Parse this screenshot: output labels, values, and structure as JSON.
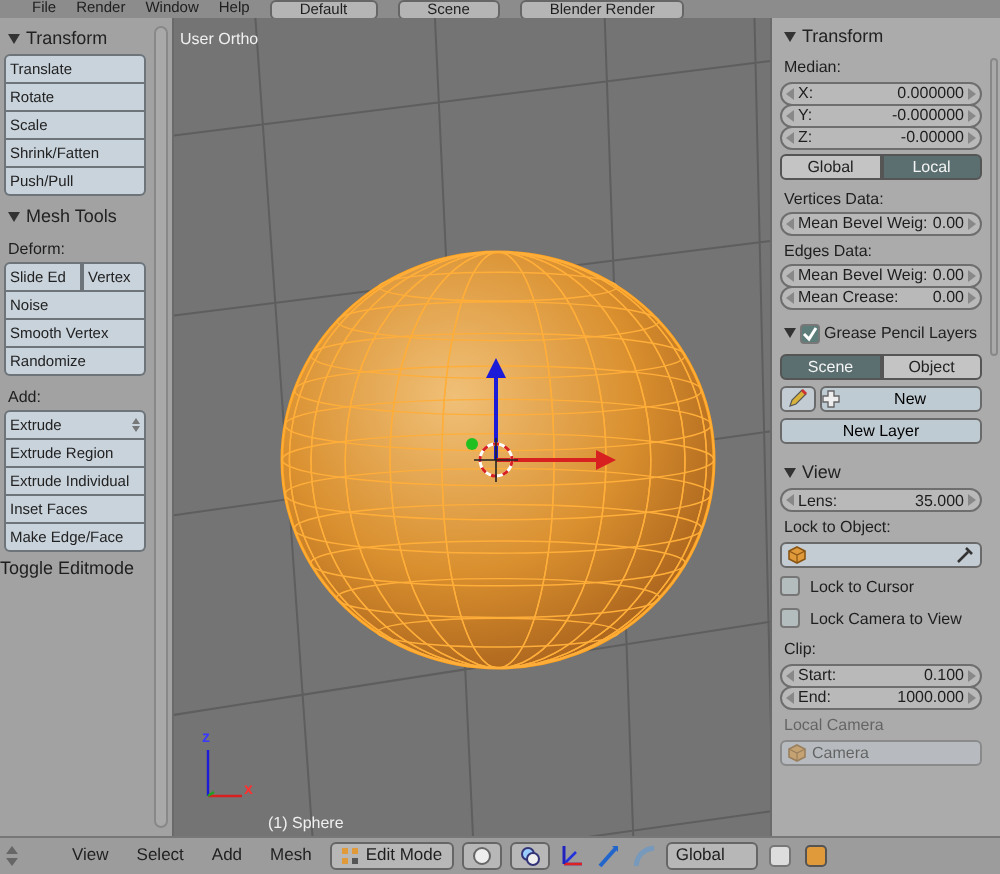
{
  "top_bar": {
    "menus": [
      "File",
      "Render",
      "Window",
      "Help"
    ],
    "layout": "Default",
    "scene": "Scene",
    "engine": "Blender Render"
  },
  "tool_shelf": {
    "panels": [
      {
        "title": "Transform",
        "items": [
          {
            "kind": "buttons",
            "buttons": [
              "Translate",
              "Rotate",
              "Scale",
              "Shrink/Fatten",
              "Push/Pull"
            ]
          }
        ]
      },
      {
        "title": "Mesh Tools",
        "items": [
          {
            "kind": "label",
            "text": "Deform:"
          },
          {
            "kind": "row",
            "buttons": [
              "Slide Ed",
              "Vertex"
            ]
          },
          {
            "kind": "buttons",
            "buttons": [
              "Noise",
              "Smooth Vertex",
              "Randomize"
            ]
          },
          {
            "kind": "label",
            "text": "Add:"
          },
          {
            "kind": "dropdown",
            "text": "Extrude"
          },
          {
            "kind": "buttons",
            "buttons": [
              "Extrude Region",
              "Extrude Individual",
              "Inset Faces",
              "Make Edge/Face"
            ]
          }
        ]
      }
    ],
    "operator": "Toggle Editmode"
  },
  "viewport": {
    "view_name": "User Ortho",
    "object_label": "(1) Sphere",
    "axis_labels": [
      "z",
      "x"
    ]
  },
  "properties": {
    "panels": [
      {
        "title": "Transform",
        "items": [
          {
            "kind": "label",
            "text": "Median:"
          },
          {
            "kind": "fields",
            "fields": [
              {
                "label": "X:",
                "value": "0.000000"
              },
              {
                "label": "Y:",
                "value": "-0.000000"
              },
              {
                "label": "Z:",
                "value": "-0.00000"
              }
            ]
          },
          {
            "kind": "toggle",
            "options": [
              {
                "label": "Global",
                "selected": false
              },
              {
                "label": "Local",
                "selected": true
              }
            ]
          },
          {
            "kind": "label",
            "text": "Vertices Data:"
          },
          {
            "kind": "fields",
            "fields": [
              {
                "label": "Mean Bevel Weig:",
                "value": "0.00"
              }
            ]
          },
          {
            "kind": "label",
            "text": "Edges Data:"
          },
          {
            "kind": "fields",
            "fields": [
              {
                "label": "Mean Bevel Weig:",
                "value": "0.00"
              },
              {
                "label": "Mean Crease:",
                "value": "0.00"
              }
            ]
          }
        ]
      },
      {
        "title": "Grease Pencil Layers",
        "checked": true,
        "items": [
          {
            "kind": "toggle",
            "options": [
              {
                "label": "Scene",
                "selected": true
              },
              {
                "label": "Object",
                "selected": false
              }
            ]
          },
          {
            "kind": "new",
            "text": "New"
          },
          {
            "kind": "button",
            "text": "New Layer"
          }
        ]
      },
      {
        "title": "View",
        "items": [
          {
            "kind": "fields",
            "fields": [
              {
                "label": "Lens:",
                "value": "35.000"
              }
            ]
          },
          {
            "kind": "label",
            "text": "Lock to Object:"
          },
          {
            "kind": "object_field"
          },
          {
            "kind": "checkbox",
            "text": "Lock to Cursor",
            "checked": false
          },
          {
            "kind": "checkbox",
            "text": "Lock Camera to View",
            "checked": false
          },
          {
            "kind": "label",
            "text": "Clip:"
          },
          {
            "kind": "fields",
            "fields": [
              {
                "label": "Start:",
                "value": "0.100"
              },
              {
                "label": "End:",
                "value": "1000.000"
              }
            ]
          },
          {
            "kind": "label",
            "text": "Local Camera",
            "disabled": true
          },
          {
            "kind": "camera_field",
            "text": "Camera",
            "disabled": true
          }
        ]
      }
    ]
  },
  "header": {
    "menus": [
      "View",
      "Select",
      "Add",
      "Mesh"
    ],
    "mode": "Edit Mode",
    "orientation": "Global"
  }
}
